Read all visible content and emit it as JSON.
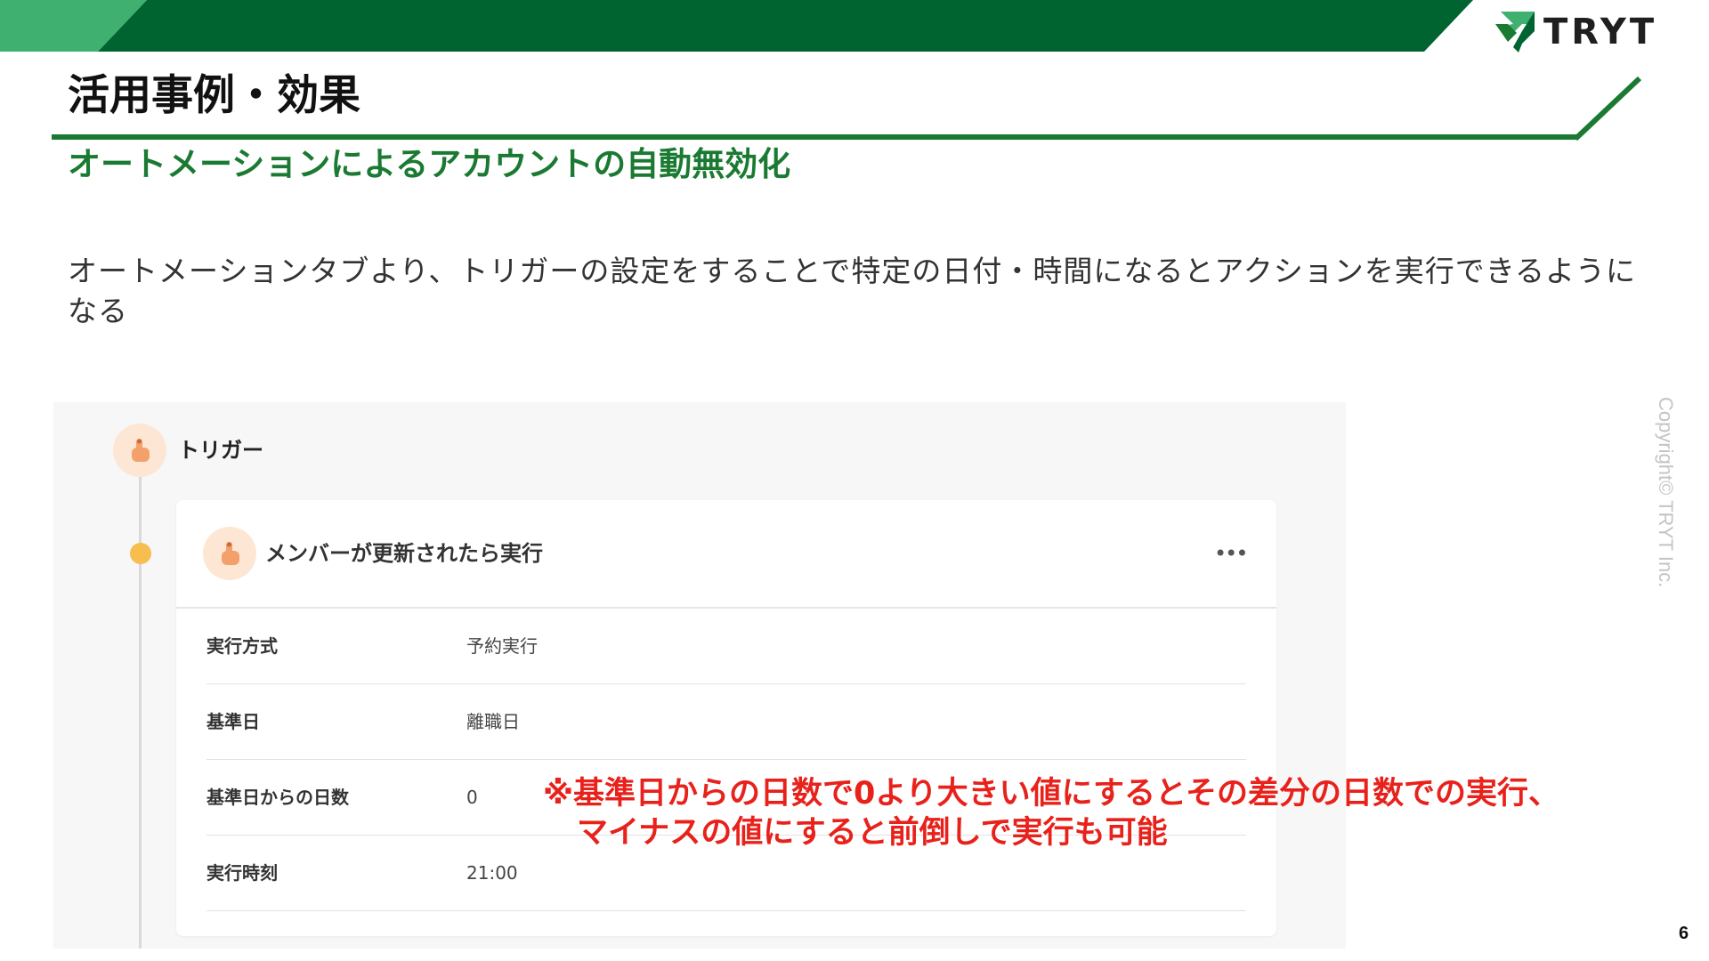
{
  "header": {
    "logo_text": "TRYT",
    "page_title": "活用事例・効果",
    "subtitle": "オートメーションによるアカウントの自動無効化"
  },
  "body": {
    "description": "オートメーションタブより、トリガーの設定をすることで特定の日付・時間になるとアクションを実行できるようになる"
  },
  "panel": {
    "trigger_label": "トリガー",
    "card": {
      "title": "メンバーが更新されたら実行",
      "more_icon": "more-horizontal-icon",
      "rows": [
        {
          "label": "実行方式",
          "value": "予約実行"
        },
        {
          "label": "基準日",
          "value": "離職日"
        },
        {
          "label": "基準日からの日数",
          "value": "0"
        },
        {
          "label": "実行時刻",
          "value": "21:00"
        }
      ]
    }
  },
  "note": {
    "line1": "※基準日からの日数で0より大きい値にするとその差分の日数での実行、",
    "line2": "マイナスの値にすると前倒しで実行も可能"
  },
  "footer": {
    "copyright": "Copyright© TRYT Inc.",
    "page_number": "6"
  },
  "colors": {
    "dark_green": "#006430",
    "light_green": "#3fb070",
    "accent_green": "#1b7a32",
    "note_red": "#e8211b",
    "icon_bg": "#fde7d4",
    "dot_yellow": "#f8bd4f"
  }
}
